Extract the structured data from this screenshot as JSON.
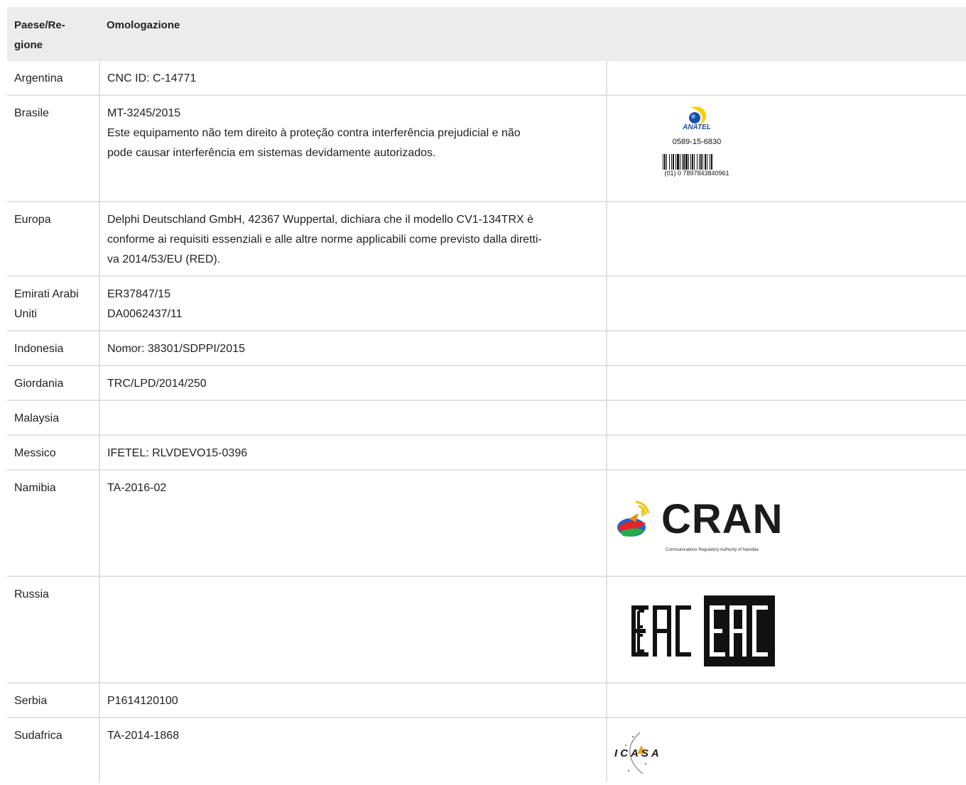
{
  "header": {
    "country": "Paese/Re-\ngione",
    "approval": "Omologazione"
  },
  "rows": [
    {
      "country": "Argentina",
      "lines": [
        "CNC ID: C-14771"
      ]
    },
    {
      "country": "Brasile",
      "lines": [
        "MT-3245/2015",
        "Este equipamento não tem direito à proteção contra interferência prejudicial e não",
        "pode causar interferência em sistemas devidamente autorizados."
      ]
    },
    {
      "country": "Europa",
      "lines": [
        "Delphi Deutschland GmbH, 42367 Wuppertal, dichiara che il modello CV1-134TRX è",
        "conforme ai requisiti essenziali e alle altre norme applicabili come previsto dalla diretti-",
        "va 2014/53/EU (RED)."
      ]
    },
    {
      "country": "Emirati Arabi Uniti",
      "lines": [
        "ER37847/15",
        "DA0062437/11"
      ]
    },
    {
      "country": "Indonesia",
      "lines": [
        "Nomor: 38301/SDPPI/2015"
      ]
    },
    {
      "country": "Giordania",
      "lines": [
        "TRC/LPD/2014/250"
      ]
    },
    {
      "country": "Malaysia",
      "lines": []
    },
    {
      "country": "Messico",
      "lines": [
        "IFETEL: RLVDEVO15-0396"
      ]
    },
    {
      "country": "Namibia",
      "lines": [
        "TA-2016-02"
      ]
    },
    {
      "country": "Russia",
      "lines": []
    },
    {
      "country": "Serbia",
      "lines": [
        "P1614120100"
      ]
    },
    {
      "country": "Sudafrica",
      "lines": [
        "TA-2014-1868"
      ]
    }
  ],
  "logos": {
    "anatel": {
      "icon": "anatel-logo-icon",
      "word": "ANATEL",
      "code": "0589-15-6830",
      "barcode_text": "(01) 0 7897843840961"
    },
    "cran": {
      "icon": "cran-logo-icon",
      "word": "CRAN",
      "subtitle": "Communications Regulatory Authority of Namibia"
    },
    "eac": {
      "icon": "eac-mark-icon"
    },
    "icasa": {
      "icon": "icasa-logo-icon",
      "word": "ICASA"
    }
  },
  "colors": {
    "header_bg": "#ececec",
    "border": "#e2e2e2",
    "anatel_blue": "#1a4fa8",
    "anatel_yellow": "#f2d200"
  }
}
